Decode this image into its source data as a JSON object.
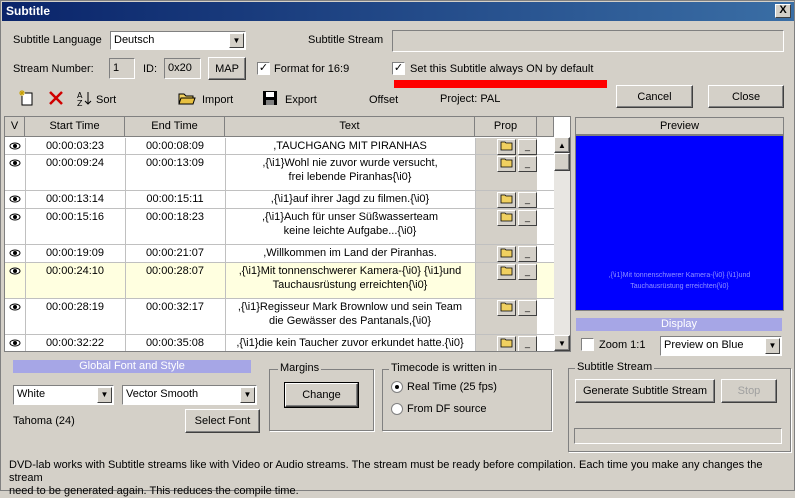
{
  "window": {
    "title": "Subtitle",
    "close_label": "X"
  },
  "top": {
    "subtitle_language_label": "Subtitle Language",
    "subtitle_language_value": "Deutsch",
    "subtitle_stream_label": "Subtitle Stream",
    "subtitle_stream_value": "",
    "stream_number_label": "Stream Number:",
    "stream_number_value": "1",
    "id_label": "ID:",
    "id_value": "0x20",
    "map_label": "MAP",
    "format_label": "Format for 16:9",
    "format_checked": true,
    "always_on_label": "Set this Subtitle always ON by default",
    "always_on_checked": true
  },
  "toolbar": {
    "sort_label": "Sort",
    "import_label": "Import",
    "export_label": "Export",
    "offset_label": "Offset",
    "project_label": "Project: PAL",
    "cancel_label": "Cancel",
    "close_label": "Close"
  },
  "table": {
    "headers": [
      "V",
      "Start Time",
      "End Time",
      "Text",
      "Prop"
    ],
    "rows": [
      {
        "start": "00:00:03:23",
        "end": "00:00:08:09",
        "text1": ",TAUCHGANG MIT PIRANHAS",
        "text2": ""
      },
      {
        "start": "00:00:09:24",
        "end": "00:00:13:09",
        "text1": ",{\\i1}Wohl nie zuvor wurde versucht,",
        "text2": "frei lebende Piranhas{\\i0}"
      },
      {
        "start": "00:00:13:14",
        "end": "00:00:15:11",
        "text1": ",{\\i1}auf ihrer Jagd zu filmen.{\\i0}",
        "text2": ""
      },
      {
        "start": "00:00:15:16",
        "end": "00:00:18:23",
        "text1": ",{\\i1}Auch für unser Süßwasserteam",
        "text2": "keine leichte Aufgabe...{\\i0}"
      },
      {
        "start": "00:00:19:09",
        "end": "00:00:21:07",
        "text1": ",Willkommen im Land der Piranhas.",
        "text2": ""
      },
      {
        "start": "00:00:24:10",
        "end": "00:00:28:07",
        "text1": ",{\\i1}Mit tonnenschwerer Kamera-{\\i0} {\\i1}und",
        "text2": "Tauchausrüstung erreichten{\\i0}"
      },
      {
        "start": "00:00:28:19",
        "end": "00:00:32:17",
        "text1": ",{\\i1}Regisseur Mark Brownlow und sein Team",
        "text2": "die Gewässer des Pantanals,{\\i0}"
      },
      {
        "start": "00:00:32:22",
        "end": "00:00:35:08",
        "text1": ",{\\i1}die kein Taucher zuvor erkundet hatte.{\\i0}",
        "text2": ""
      }
    ]
  },
  "preview": {
    "header": "Preview",
    "text1": ",{\\i1}Mit tonnenschwerer Kamera-{\\i0} {\\i1}und",
    "text2": "Tauchausrüstung erreichten{\\i0}",
    "bg_color": "#0000ff",
    "display_label": "Display",
    "zoom_label": "Zoom 1:1",
    "preview_mode_value": "Preview on Blue"
  },
  "font": {
    "header": "Global Font and Style",
    "color_value": "White",
    "style_value": "Vector Smooth",
    "font_name": "Tahoma (24)",
    "select_font_label": "Select Font"
  },
  "margins": {
    "title": "Margins",
    "change_label": "Change"
  },
  "timecode": {
    "title": "Timecode is written in",
    "opt1": "Real Time (25 fps)",
    "opt2": "From DF source"
  },
  "stream": {
    "title": "Subtitle Stream",
    "generate_label": "Generate Subtitle Stream",
    "stop_label": "Stop"
  },
  "footer": {
    "line1": "DVD-lab works with Subtitle streams like with Video or Audio streams. The stream must be ready before compilation. Each time you make any changes the stream",
    "line2": "need to be generated again. This reduces the compile time."
  },
  "colors": {
    "accent_bar": "#ff0000",
    "title_bar": "#0a246a",
    "display_bar": "#a6a6e6"
  }
}
